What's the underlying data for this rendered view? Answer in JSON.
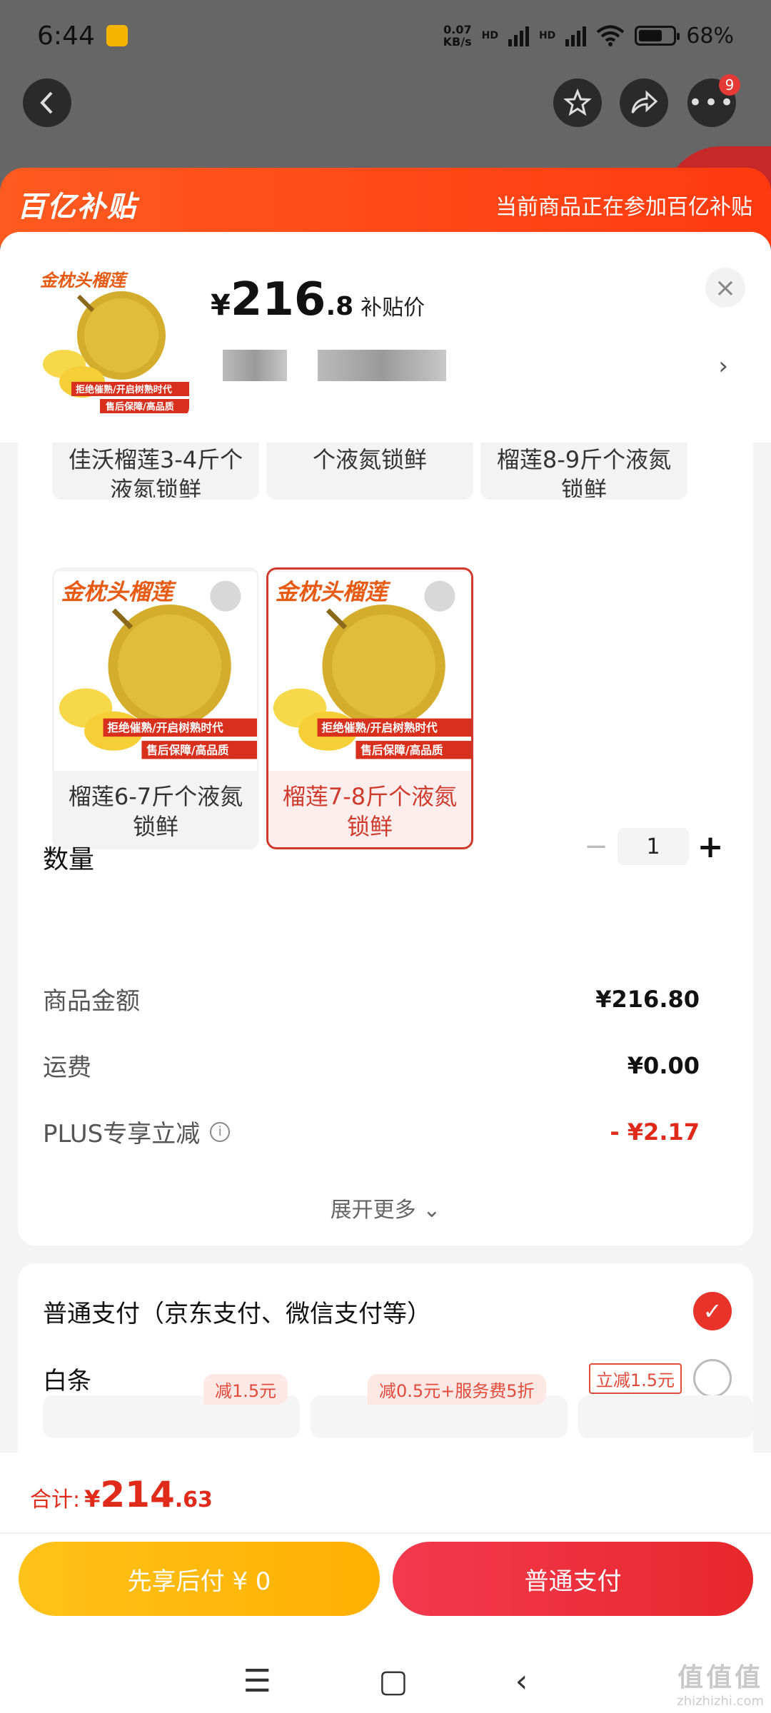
{
  "status_bar": {
    "time": "6:44",
    "speed_value": "0.07",
    "speed_unit": "KB/s",
    "signal_1": "HD",
    "signal_2": "HD",
    "battery": "68%"
  },
  "nav": {
    "back_icon": "chevron-left-icon",
    "favorite_icon": "star-icon",
    "share_icon": "share-icon",
    "more_icon": "more-dots-icon",
    "more_badge": "9"
  },
  "banner": {
    "logo": "百亿补贴",
    "tip": "当前商品正在参加百亿补贴"
  },
  "header": {
    "price_currency": "¥",
    "price_int": "216",
    "price_dec": ".8",
    "price_label": "补贴价",
    "thumb_title": "金枕头榴莲",
    "thumb_tag1": "拒绝催熟/开启树熟时代",
    "thumb_tag2": "售后保障/高品质",
    "chevron": "›",
    "close": "×"
  },
  "options": [
    {
      "label": "佳沃榴莲3-4斤个液氮锁鲜",
      "selected": false
    },
    {
      "label": "个液氮锁鲜",
      "selected": false
    },
    {
      "label": "榴莲8-9斤个液氮锁鲜",
      "selected": false
    },
    {
      "label": "榴莲6-7斤个液氮锁鲜",
      "selected": false,
      "img_title": "金枕头榴莲",
      "tag1": "拒绝催熟/开启树熟时代",
      "tag2": "售后保障/高品质"
    },
    {
      "label": "榴莲7-8斤个液氮锁鲜",
      "selected": true,
      "img_title": "金枕头榴莲",
      "tag1": "拒绝催熟/开启树熟时代",
      "tag2": "售后保障/高品质"
    }
  ],
  "quantity": {
    "label": "数量",
    "minus": "−",
    "value": "1",
    "plus": "+"
  },
  "summary": {
    "goods_label": "商品金额",
    "goods_value": "¥216.80",
    "shipping_label": "运费",
    "shipping_value": "¥0.00",
    "plus_label": "PLUS专享立减",
    "plus_value": "- ¥2.17",
    "expand": "展开更多 ⌄"
  },
  "payment": {
    "normal_label": "普通支付（京东支付、微信支付等）",
    "baitiao_label": "白条",
    "baitiao_promo": "立减1.5元",
    "chip1": "减1.5元",
    "chip2": "减0.5元+服务费5折"
  },
  "bottom": {
    "total_label": "合计:",
    "total_currency": "¥",
    "total_int": "214",
    "total_dec": ".63",
    "btn_later": "先享后付 ¥ 0",
    "btn_normal": "普通支付"
  },
  "watermark": {
    "logo": "值值值",
    "site": "zhizhizhi.com"
  },
  "colors": {
    "accent_red": "#e02a1a",
    "banner": "#ff4a17",
    "btn_yellow": "#ffb000",
    "btn_red": "#e6282c"
  }
}
